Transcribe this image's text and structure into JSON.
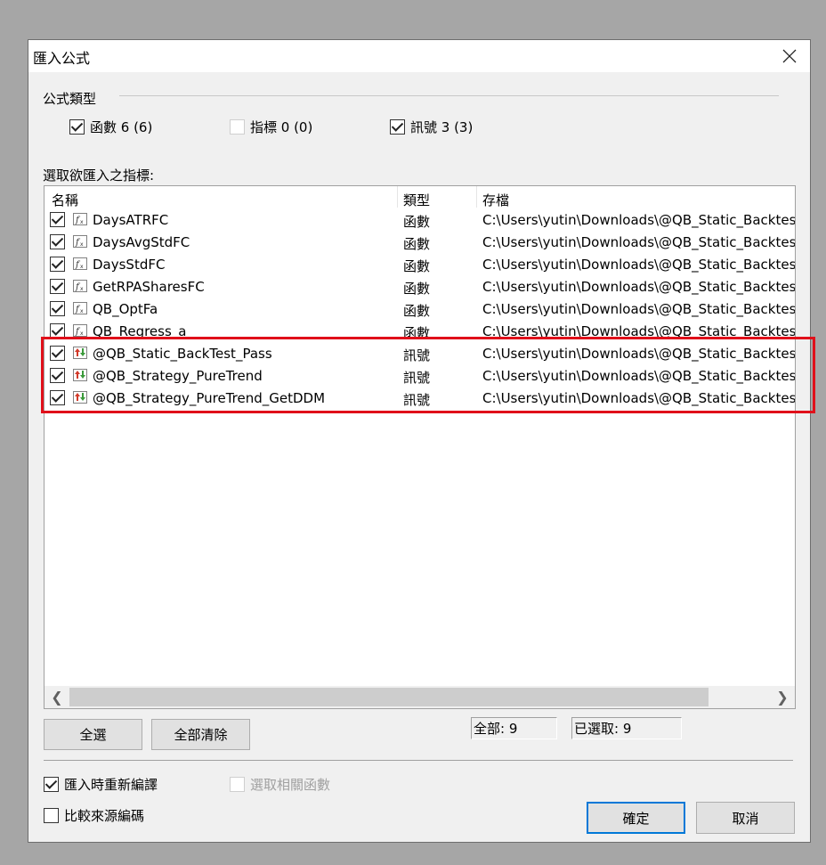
{
  "dialog": {
    "title": "匯入公式"
  },
  "formula_type": {
    "group_label": "公式類型",
    "items": [
      {
        "label": "函數 6 (6)",
        "checked": true
      },
      {
        "label": "指標 0 (0)",
        "checked": false
      },
      {
        "label": "訊號 3 (3)",
        "checked": true
      }
    ]
  },
  "list": {
    "caption": "選取欲匯入之指標:",
    "headers": {
      "name": "名稱",
      "type": "類型",
      "path": "存檔"
    },
    "rows": [
      {
        "name": "DaysATRFC",
        "type": "函數",
        "path": "C:\\Users\\yutin\\Downloads\\@QB_Static_Backtest_",
        "icon": "function-icon",
        "checked": true
      },
      {
        "name": "DaysAvgStdFC",
        "type": "函數",
        "path": "C:\\Users\\yutin\\Downloads\\@QB_Static_Backtest_",
        "icon": "function-icon",
        "checked": true
      },
      {
        "name": "DaysStdFC",
        "type": "函數",
        "path": "C:\\Users\\yutin\\Downloads\\@QB_Static_Backtest_",
        "icon": "function-icon",
        "checked": true
      },
      {
        "name": "GetRPASharesFC",
        "type": "函數",
        "path": "C:\\Users\\yutin\\Downloads\\@QB_Static_Backtest_",
        "icon": "function-icon",
        "checked": true
      },
      {
        "name": "QB_OptFa",
        "type": "函數",
        "path": "C:\\Users\\yutin\\Downloads\\@QB_Static_Backtest_",
        "icon": "function-icon",
        "checked": true
      },
      {
        "name": "QB_Regress_a",
        "type": "函數",
        "path": "C:\\Users\\yutin\\Downloads\\@QB_Static_Backtest_",
        "icon": "function-icon",
        "checked": true
      },
      {
        "name": "@QB_Static_BackTest_Pass",
        "type": "訊號",
        "path": "C:\\Users\\yutin\\Downloads\\@QB_Static_Backtest_",
        "icon": "signal-icon",
        "checked": true
      },
      {
        "name": "@QB_Strategy_PureTrend",
        "type": "訊號",
        "path": "C:\\Users\\yutin\\Downloads\\@QB_Static_Backtest_",
        "icon": "signal-icon",
        "checked": true
      },
      {
        "name": "@QB_Strategy_PureTrend_GetDDM",
        "type": "訊號",
        "path": "C:\\Users\\yutin\\Downloads\\@QB_Static_Backtest_",
        "icon": "signal-icon",
        "checked": true
      }
    ]
  },
  "buttons": {
    "select_all": "全選",
    "clear_all": "全部清除",
    "ok": "確定",
    "cancel": "取消"
  },
  "counters": {
    "total": "全部: 9",
    "selected": "已選取: 9"
  },
  "options": {
    "recompile": {
      "label": "匯入時重新編譯",
      "checked": true
    },
    "select_related": {
      "label": "選取相關函數",
      "checked": false,
      "disabled": true
    },
    "compare_source": {
      "label": "比較來源編碼",
      "checked": false
    }
  },
  "colors": {
    "highlight_box": "#e0101a",
    "default_button_border": "#0078d7"
  }
}
